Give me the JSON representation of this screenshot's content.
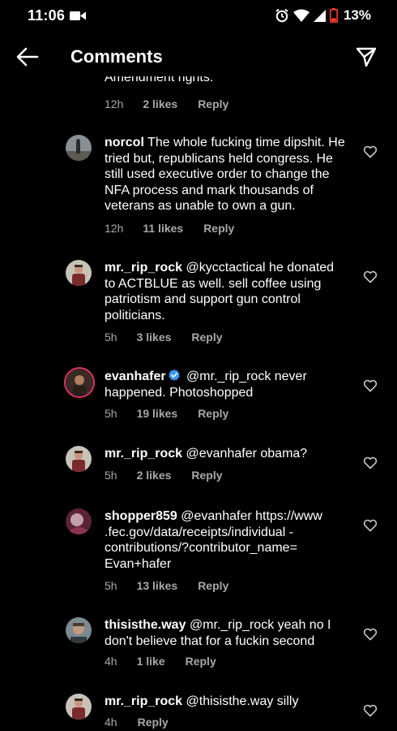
{
  "status_bar": {
    "time": "11:06",
    "battery_pct": "13%"
  },
  "header": {
    "title": "Comments"
  },
  "partial_comment": {
    "text_fragment": "Amendment rights.",
    "time": "12h",
    "likes": "2 likes",
    "reply": "Reply"
  },
  "comments": [
    {
      "username": "norcol",
      "text": "The whole fucking time dipshit. He tried but, republicans held congress. He still used executive order to change the NFA process and mark thousands of veterans as unable to own a gun.",
      "time": "12h",
      "likes": "11 likes",
      "reply": "Reply"
    },
    {
      "username": "mr._rip_rock",
      "text": "@kycctactical he donated to ACTBLUE as well. sell coffee using patriotism and support gun control politicians.",
      "time": "5h",
      "likes": "3 likes",
      "reply": "Reply"
    },
    {
      "username": "evanhafer",
      "verified": true,
      "text": "@mr._rip_rock never happened. Photoshopped",
      "time": "5h",
      "likes": "19 likes",
      "reply": "Reply"
    },
    {
      "username": "mr._rip_rock",
      "text": "@evanhafer obama?",
      "time": "5h",
      "likes": "2 likes",
      "reply": "Reply"
    },
    {
      "username": "shopper859",
      "text": "@evanhafer https://www .fec.gov/data/receipts/individual -contributions/?contributor_name= Evan+hafer",
      "time": "5h",
      "likes": "13 likes",
      "reply": "Reply"
    },
    {
      "username": "thisisthe.way",
      "text": "@mr._rip_rock yeah no I don't believe that for a fuckin second",
      "time": "4h",
      "likes": "1 like",
      "reply": "Reply"
    },
    {
      "username": "mr._rip_rock",
      "text": "@thisisthe.way silly",
      "time": "4h",
      "likes": "",
      "reply": "Reply"
    }
  ],
  "colors": {
    "background": "#000000",
    "text": "#ffffff",
    "meta": "#a8a8a8",
    "verified": "#3897f0"
  }
}
